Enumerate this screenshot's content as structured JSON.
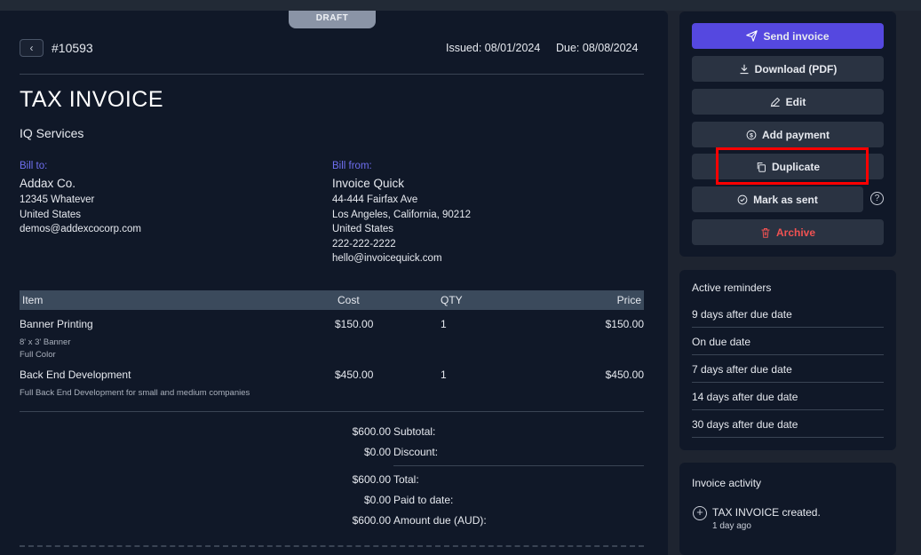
{
  "status_tab": "DRAFT",
  "header": {
    "invoice_number": "#10593",
    "issued": "Issued: 08/01/2024",
    "due": "Due: 08/08/2024"
  },
  "doc": {
    "title": "TAX INVOICE",
    "company": "IQ Services"
  },
  "bill_to": {
    "label": "Bill to:",
    "name": "Addax Co.",
    "lines": [
      "12345 Whatever",
      "United States",
      "demos@addexcocorp.com"
    ]
  },
  "bill_from": {
    "label": "Bill from:",
    "name": "Invoice Quick",
    "lines": [
      "44-444 Fairfax Ave",
      "Los Angeles, California, 90212",
      "United States",
      "222-222-2222",
      "hello@invoicequick.com"
    ]
  },
  "table": {
    "columns": [
      "Item",
      "Cost",
      "QTY",
      "Price"
    ],
    "rows": [
      {
        "item": "Banner Printing",
        "cost": "$150.00",
        "qty": "1",
        "price": "$150.00",
        "desc": [
          "8' x 3' Banner",
          "Full Color"
        ]
      },
      {
        "item": "Back End Development",
        "cost": "$450.00",
        "qty": "1",
        "price": "$450.00",
        "desc": [
          "Full Back End Development for small and medium companies"
        ]
      }
    ]
  },
  "totals": {
    "subtotal_label": "Subtotal:",
    "subtotal": "$600.00",
    "discount_label": "Discount:",
    "discount": "$0.00",
    "total_label": "Total:",
    "total": "$600.00",
    "paid_label": "Paid to date:",
    "paid": "$0.00",
    "amount_due_label": "Amount due (AUD):",
    "amount_due": "$600.00"
  },
  "actions": {
    "send": "Send invoice",
    "download": "Download (PDF)",
    "edit": "Edit",
    "add_payment": "Add payment",
    "duplicate": "Duplicate",
    "mark_sent": "Mark as sent",
    "help": "?",
    "archive": "Archive"
  },
  "reminders": {
    "title": "Active reminders",
    "items": [
      "9 days after due date",
      "On due date",
      "7 days after due date",
      "14 days after due date",
      "30 days after due date"
    ]
  },
  "activity": {
    "title": "Invoice activity",
    "event": "TAX INVOICE created.",
    "time": "1 day ago"
  },
  "colors": {
    "primary": "#5548e0",
    "danger": "#f05252",
    "label_accent": "#6f6ff0",
    "highlight": "#ff0000"
  }
}
